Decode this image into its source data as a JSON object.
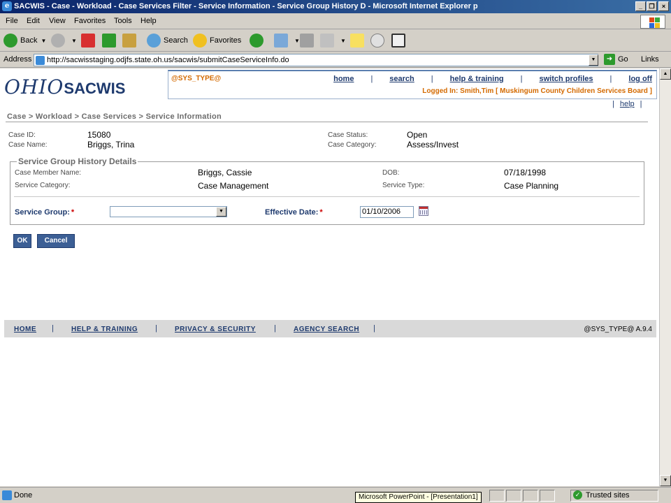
{
  "window": {
    "title": "SACWIS - Case - Workload - Case Services Filter - Service Information - Service Group History D - Microsoft Internet Explorer p"
  },
  "menubar": [
    "File",
    "Edit",
    "View",
    "Favorites",
    "Tools",
    "Help"
  ],
  "toolbar": {
    "back": "Back",
    "search": "Search",
    "favorites": "Favorites"
  },
  "address": {
    "label": "Address",
    "url": "http://sacwisstaging.odjfs.state.oh.us/sacwis/submitCaseServiceInfo.do",
    "go": "Go",
    "links": "Links"
  },
  "header": {
    "logo_ohio": "OHIO",
    "logo_sacwis": "SACWIS",
    "sys_type": "@SYS_TYPE@",
    "nav": [
      "home",
      "search",
      "help & training",
      "switch profiles",
      "log off"
    ],
    "logged_in": "Logged In:  Smith,Tim [ Muskingum County Children Services Board ]",
    "help": "help"
  },
  "breadcrumb": "Case > Workload > Case Services > Service Information",
  "case": {
    "id_label": "Case ID:",
    "id": "15080",
    "name_label": "Case Name:",
    "name": "Briggs, Trina",
    "status_label": "Case Status:",
    "status": "Open",
    "category_label": "Case Category:",
    "category": "Assess/Invest"
  },
  "details": {
    "legend": "Service Group History Details",
    "member_label": "Case Member Name:",
    "member": "Briggs,  Cassie",
    "dob_label": "DOB:",
    "dob": "07/18/1998",
    "service_category_label": "Service Category:",
    "service_category": "Case Management",
    "service_type_label": "Service Type:",
    "service_type": "Case Planning",
    "service_group_label": "Service Group:",
    "effective_date_label": "Effective Date:",
    "effective_date": "01/10/2006",
    "required_mark": "*"
  },
  "buttons": {
    "ok": "OK",
    "cancel": "Cancel"
  },
  "footer": {
    "links": [
      "HOME",
      "HELP & TRAINING",
      "PRIVACY & SECURITY",
      "AGENCY SEARCH"
    ],
    "version": "@SYS_TYPE@ A.9.4"
  },
  "statusbar": {
    "done": "Done",
    "tooltip": "Microsoft PowerPoint - [Presentation1]",
    "zone": "Trusted sites"
  }
}
